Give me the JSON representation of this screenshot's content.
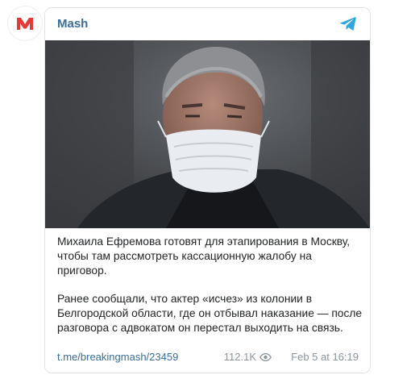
{
  "channel": {
    "name": "Mash",
    "avatar_letter": "M",
    "avatar_color": "#e53935"
  },
  "post": {
    "paragraphs": [
      "Михаила Ефремова готовят для этапирования в Москву, чтобы там рассмотреть кассационную жалобу на приговор.",
      "Ранее сообщали, что актер «исчез» из колонии в Белгородской области, где он отбывал наказание — после разговора с адвокатом он перестал выходить на связь."
    ],
    "link": "t.me/breakingmash/23459",
    "views": "112.1K",
    "date": "Feb 5 at 16:19"
  },
  "icons": {
    "telegram": "telegram-plane-icon",
    "views": "eye-icon"
  },
  "colors": {
    "accent": "#3a6d99",
    "telegram": "#2ea6df",
    "muted": "#8b959e"
  }
}
